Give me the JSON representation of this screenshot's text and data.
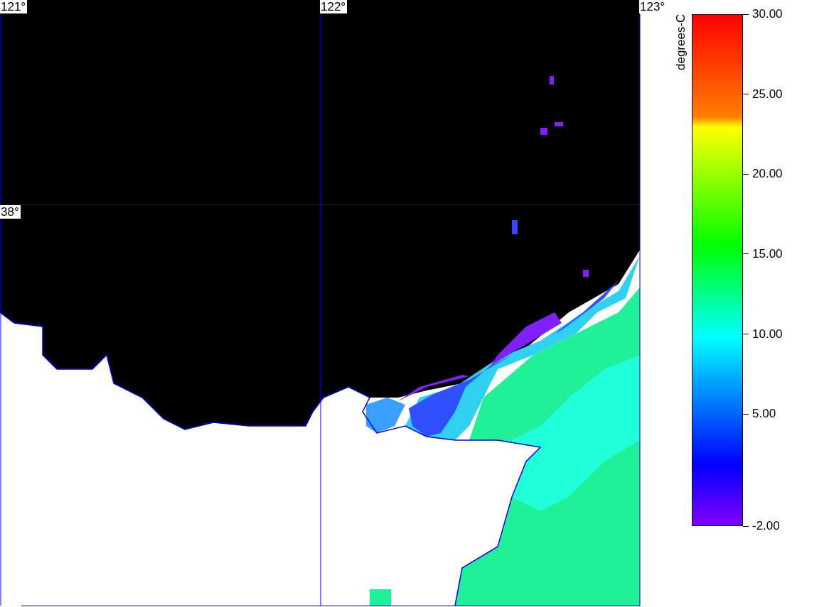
{
  "map": {
    "grid_labels": [
      {
        "kind": "lon",
        "text": "121°"
      },
      {
        "kind": "lon",
        "text": "122°"
      },
      {
        "kind": "lon",
        "text": "123°"
      },
      {
        "kind": "lat",
        "text": "38°"
      }
    ]
  },
  "colorbar": {
    "unit": "degrees-C",
    "ticks": [
      "30.00",
      "25.00",
      "20.00",
      "15.00",
      "10.00",
      "5.00",
      "-2.00"
    ]
  }
}
